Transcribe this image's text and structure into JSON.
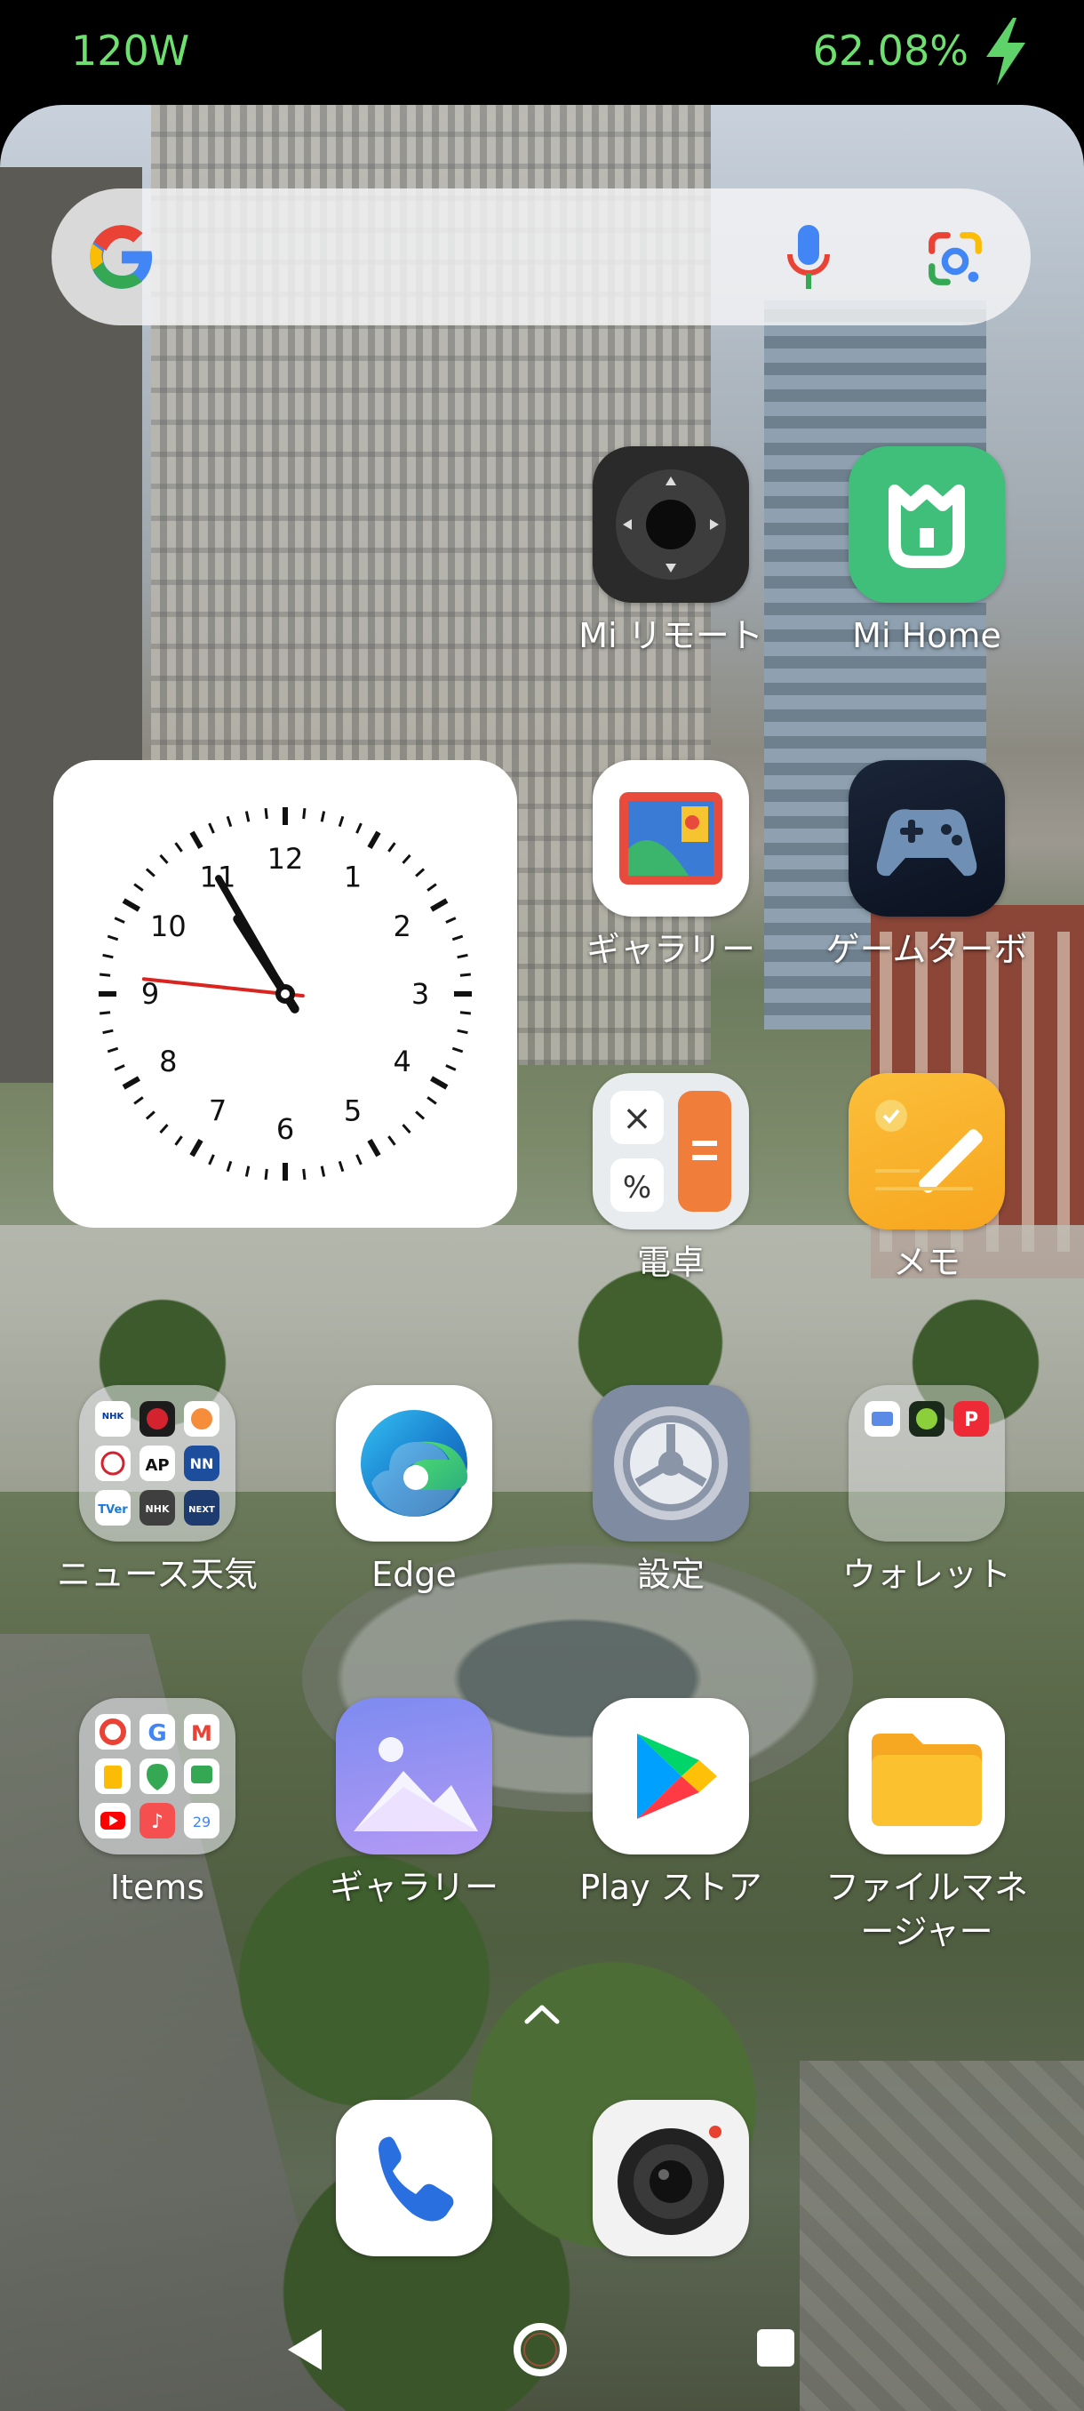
{
  "status_bar": {
    "power": "120W",
    "battery": "62.08%",
    "icon": "charging-bolt-icon"
  },
  "search_bar": {
    "logo": "google-g-icon",
    "mic": "mic-icon",
    "lens": "google-lens-icon"
  },
  "clock_widget": {
    "numerals": [
      "12",
      "1",
      "2",
      "3",
      "4",
      "5",
      "6",
      "7",
      "8",
      "9",
      "10",
      "11"
    ],
    "hour": 10,
    "minute": 55,
    "second": 46
  },
  "apps": {
    "mi_remote": {
      "label": "Mi リモート",
      "icon": "remote-icon"
    },
    "mi_home": {
      "label": "Mi Home",
      "icon": "mi-home-icon"
    },
    "gallery1": {
      "label": "ギャラリー",
      "icon": "gallery-icon"
    },
    "game_turbo": {
      "label": "ゲームターボ",
      "icon": "gamepad-icon"
    },
    "calculator": {
      "label": "電卓",
      "icon": "calculator-icon"
    },
    "notes": {
      "label": "メモ",
      "icon": "notes-icon"
    },
    "news_folder": {
      "label": "ニュース天気",
      "icon": "folder-icon"
    },
    "edge": {
      "label": "Edge",
      "icon": "edge-icon"
    },
    "settings": {
      "label": "設定",
      "icon": "gear-icon"
    },
    "wallet": {
      "label": "ウォレット",
      "icon": "wallet-folder-icon"
    },
    "items": {
      "label": "Items",
      "icon": "folder-icon"
    },
    "gallery2": {
      "label": "ギャラリー",
      "icon": "gallery-icon"
    },
    "play_store": {
      "label": "Play ストア",
      "icon": "play-store-icon"
    },
    "file_manager": {
      "label": "ファイルマネージャー",
      "label_line1": "ファイルマネ",
      "label_line2": "ージャー",
      "icon": "folder-file-icon"
    }
  },
  "folder_minis": {
    "news": [
      "NHK ニュース 防災",
      "",
      "",
      "",
      "AP",
      "NN",
      "TVer",
      "NHK",
      "NEXT"
    ]
  },
  "dock": {
    "phone": "phone-icon",
    "camera": "camera-icon"
  },
  "nav": {
    "back": "back-icon",
    "home": "home-icon",
    "recents": "recents-icon",
    "drawer": "chevron-up-icon"
  }
}
